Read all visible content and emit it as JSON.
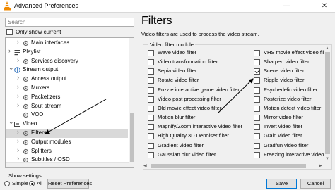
{
  "window": {
    "title": "Advanced Preferences",
    "minimize_glyph": "—",
    "close_glyph": "✕"
  },
  "sidebar": {
    "search_placeholder": "Search",
    "show_current_label": "Only show current",
    "tree": [
      {
        "label": "Main interfaces",
        "level": 2,
        "expand": "right",
        "icon": "gear-icon"
      },
      {
        "label": "Playlist",
        "level": 1,
        "expand": "right",
        "icon": "playlist-icon"
      },
      {
        "label": "Services discovery",
        "level": 2,
        "expand": "right",
        "icon": "gear-icon"
      },
      {
        "label": "Stream output",
        "level": 1,
        "expand": "down",
        "icon": "stream-icon"
      },
      {
        "label": "Access output",
        "level": 2,
        "expand": "right",
        "icon": "gear-icon"
      },
      {
        "label": "Muxers",
        "level": 2,
        "expand": "right",
        "icon": "gear-icon"
      },
      {
        "label": "Packetizers",
        "level": 2,
        "expand": "right",
        "icon": "gear-icon"
      },
      {
        "label": "Sout stream",
        "level": 2,
        "expand": "right",
        "icon": "gear-icon"
      },
      {
        "label": "VOD",
        "level": 2,
        "expand": "",
        "icon": "gear-icon"
      },
      {
        "label": "Video",
        "level": 1,
        "expand": "down",
        "icon": "video-icon"
      },
      {
        "label": "Filters",
        "level": 2,
        "expand": "right",
        "icon": "gear-icon",
        "selected": true
      },
      {
        "label": "Output modules",
        "level": 2,
        "expand": "right",
        "icon": "gear-icon"
      },
      {
        "label": "Splitters",
        "level": 2,
        "expand": "right",
        "icon": "gear-icon"
      },
      {
        "label": "Subtitles / OSD",
        "level": 2,
        "expand": "right",
        "icon": "gear-icon"
      }
    ]
  },
  "footer": {
    "show_settings_label": "Show settings",
    "simple_label": "Simple",
    "all_label": "All",
    "selected_mode": "All",
    "reset_button": "Reset Preferences",
    "save_button": "Save",
    "cancel_button": "Cancel"
  },
  "panel": {
    "title": "Filters",
    "description": "Video filters are used to process the video stream.",
    "module_group_title": "Video filter module",
    "filters_left": [
      {
        "label": "Wave video filter",
        "checked": false
      },
      {
        "label": "Video transformation filter",
        "checked": false
      },
      {
        "label": "Sepia video filter",
        "checked": false
      },
      {
        "label": "Rotate video filter",
        "checked": false
      },
      {
        "label": "Puzzle interactive game video filter",
        "checked": false
      },
      {
        "label": "Video post processing filter",
        "checked": false
      },
      {
        "label": "Old movie effect video filter",
        "checked": false
      },
      {
        "label": "Motion blur filter",
        "checked": false
      },
      {
        "label": "Magnify/Zoom interactive video filter",
        "checked": false
      },
      {
        "label": "High Quality 3D Denoiser filter",
        "checked": false
      },
      {
        "label": "Gradient video filter",
        "checked": false
      },
      {
        "label": "Gaussian blur video filter",
        "checked": false
      }
    ],
    "filters_right": [
      {
        "label": "VHS movie effect video filter",
        "checked": false
      },
      {
        "label": "Sharpen video filter",
        "checked": false
      },
      {
        "label": "Scene video filter",
        "checked": true
      },
      {
        "label": "Ripple video filter",
        "checked": false
      },
      {
        "label": "Psychedelic video filter",
        "checked": false
      },
      {
        "label": "Posterize video filter",
        "checked": false
      },
      {
        "label": "Motion detect video filter",
        "checked": false
      },
      {
        "label": "Mirror video filter",
        "checked": false
      },
      {
        "label": "Invert video filter",
        "checked": false
      },
      {
        "label": "Grain video filter",
        "checked": false
      },
      {
        "label": "Gradfun video filter",
        "checked": false
      },
      {
        "label": "Freezing interactive video filter",
        "checked": false
      }
    ]
  },
  "colors": {
    "accent": "#0078d7",
    "selection": "#d9d9d9",
    "background": "#f0f0f0",
    "annotation": "#000000"
  }
}
